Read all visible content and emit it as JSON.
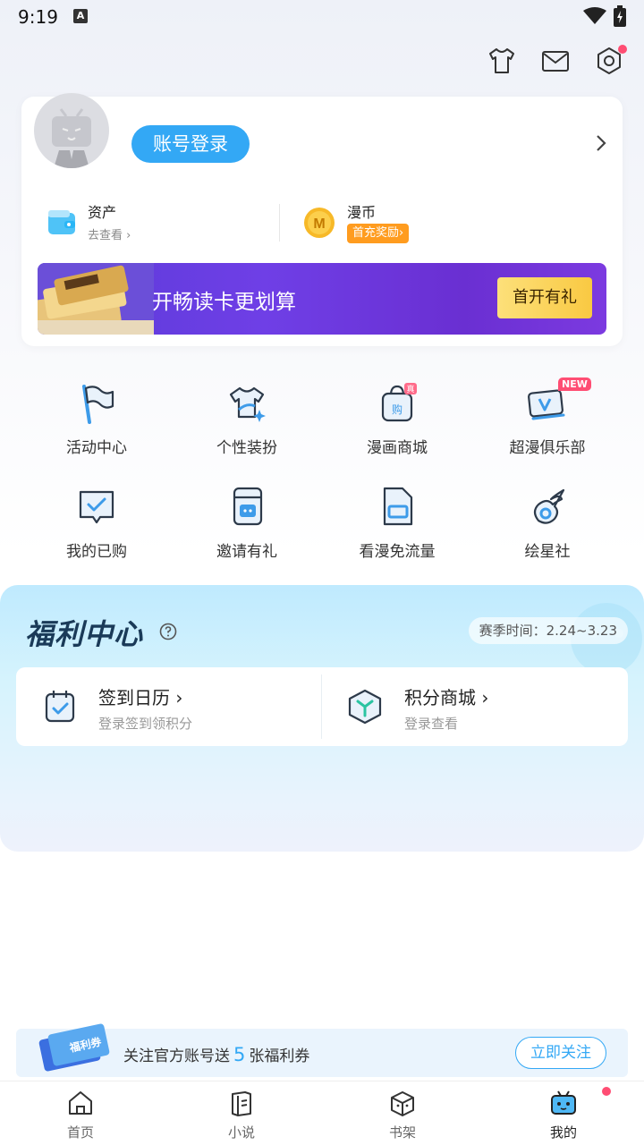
{
  "status_bar": {
    "time": "9:19",
    "notification_icon": "A"
  },
  "top_icons": [
    "tshirt-icon",
    "mail-icon",
    "settings-icon"
  ],
  "profile": {
    "login_label": "账号登录",
    "assets": {
      "title": "资产",
      "sub": "去查看"
    },
    "coins": {
      "title": "漫币",
      "reward": "首充奖励"
    },
    "coin_letter": "M"
  },
  "vip_banner": {
    "text": "开畅读卡更划算",
    "button": "首开有礼"
  },
  "grid": [
    {
      "label": "活动中心",
      "icon": "flag-icon"
    },
    {
      "label": "个性装扮",
      "icon": "tshirt-icon"
    },
    {
      "label": "漫画商城",
      "icon": "shop-bag-icon"
    },
    {
      "label": "超漫俱乐部",
      "icon": "vip-card-icon"
    },
    {
      "label": "我的已购",
      "icon": "purchased-icon"
    },
    {
      "label": "邀请有礼",
      "icon": "invite-icon"
    },
    {
      "label": "看漫免流量",
      "icon": "sim-card-icon"
    },
    {
      "label": "绘星社",
      "icon": "comet-icon"
    }
  ],
  "grid_tags": {
    "new": "NEW",
    "shop_badge": "真"
  },
  "welfare": {
    "title": "福利中心",
    "season": "赛季时间：2.24~3.23",
    "checkin": {
      "title": "签到日历",
      "sub": "登录签到领积分"
    },
    "points": {
      "title": "积分商城",
      "sub": "登录查看"
    }
  },
  "follow_bar": {
    "prefix": "关注官方账号送",
    "count": "5",
    "suffix": "张福利券",
    "button": "立即关注",
    "ticket_label": "福利券"
  },
  "bottom_nav": [
    {
      "label": "首页",
      "icon": "home-icon"
    },
    {
      "label": "小说",
      "icon": "novel-icon"
    },
    {
      "label": "书架",
      "icon": "bookshelf-icon"
    },
    {
      "label": "我的",
      "icon": "mine-icon",
      "active": true
    }
  ],
  "colors": {
    "accent": "#33a8f5",
    "badge": "#ff4d73",
    "reward": "#ff9c1f"
  }
}
